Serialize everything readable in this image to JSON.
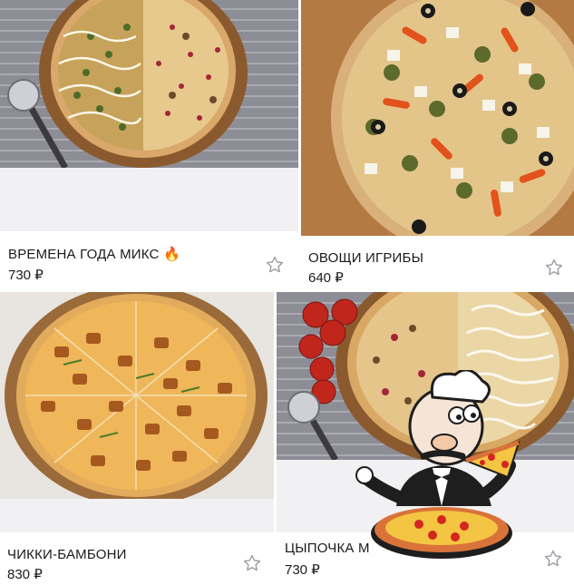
{
  "products": [
    {
      "name": "ВРЕМЕНА ГОДА МИКС",
      "emoji": "🔥",
      "price": "730 ₽"
    },
    {
      "name": "ОВОЩИ ИГРИБЫ",
      "price": "640 ₽"
    },
    {
      "name": "ЧИККИ-БАМБОНИ",
      "price": "830 ₽"
    },
    {
      "name": "ЦЫПОЧКА М",
      "price": "730 ₽"
    }
  ],
  "icons": {
    "favorite": "star-outline-icon",
    "decoration": "chef-pizza-icon"
  },
  "colors": {
    "star": "#9a9aa2",
    "gap": "#f1f1f3",
    "text": "#1a1a1a"
  }
}
